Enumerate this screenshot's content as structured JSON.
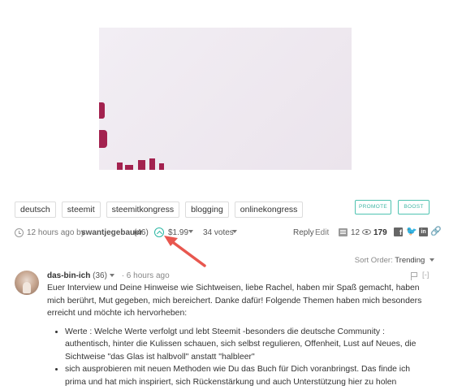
{
  "tags": [
    "deutsch",
    "steemit",
    "steemitkongress",
    "blogging",
    "onlinekongress"
  ],
  "actions": {
    "promote": "PROMOTE",
    "boost": "BOOST"
  },
  "meta": {
    "time": "12 hours ago by",
    "author": "swantjegebauer",
    "reputation": "(46)",
    "payout": "$1.99",
    "votes": "34 votes",
    "reply": "Reply",
    "edit": "Edit",
    "comments": "12",
    "views": "179"
  },
  "sort": {
    "label": "Sort Order:",
    "value": "Trending"
  },
  "comment": {
    "author": "das-bin-ich",
    "reputation": "(36)",
    "time": "· 6 hours ago",
    "collapse": "[-]",
    "paragraph": "Euer Interview und Deine Hinweise wie Sichtweisen, liebe Rachel, haben mir Spaß gemacht, haben mich berührt, Mut gegeben, mich bereichert. Danke dafür! Folgende Themen haben mich besonders erreicht und möchte ich hervorheben:",
    "bullets": [
      "Werte : Welche Werte verfolgt und lebt Steemit -besonders die deutsche Community : authentisch, hinter die Kulissen schauen, sich selbst regulieren, Offenheit, Lust auf Neues, die Sichtweise \"das Glas ist halbvoll\" anstatt \"halbleer\"",
      "sich ausprobieren mit neuen Methoden wie Du das Buch für Dich voranbringst. Das finde ich prima und hat mich inspiriert, sich Rückenstärkung und auch Unterstützung hier zu holen"
    ]
  },
  "colors": {
    "accent": "#2bb7a3",
    "arrow": "#e8574f",
    "image_accent": "#a3224f"
  },
  "icons": [
    "clock-icon",
    "upvote-icon",
    "comments-icon",
    "eye-icon",
    "facebook-icon",
    "twitter-icon",
    "linkedin-icon",
    "link-icon",
    "flag-icon"
  ]
}
